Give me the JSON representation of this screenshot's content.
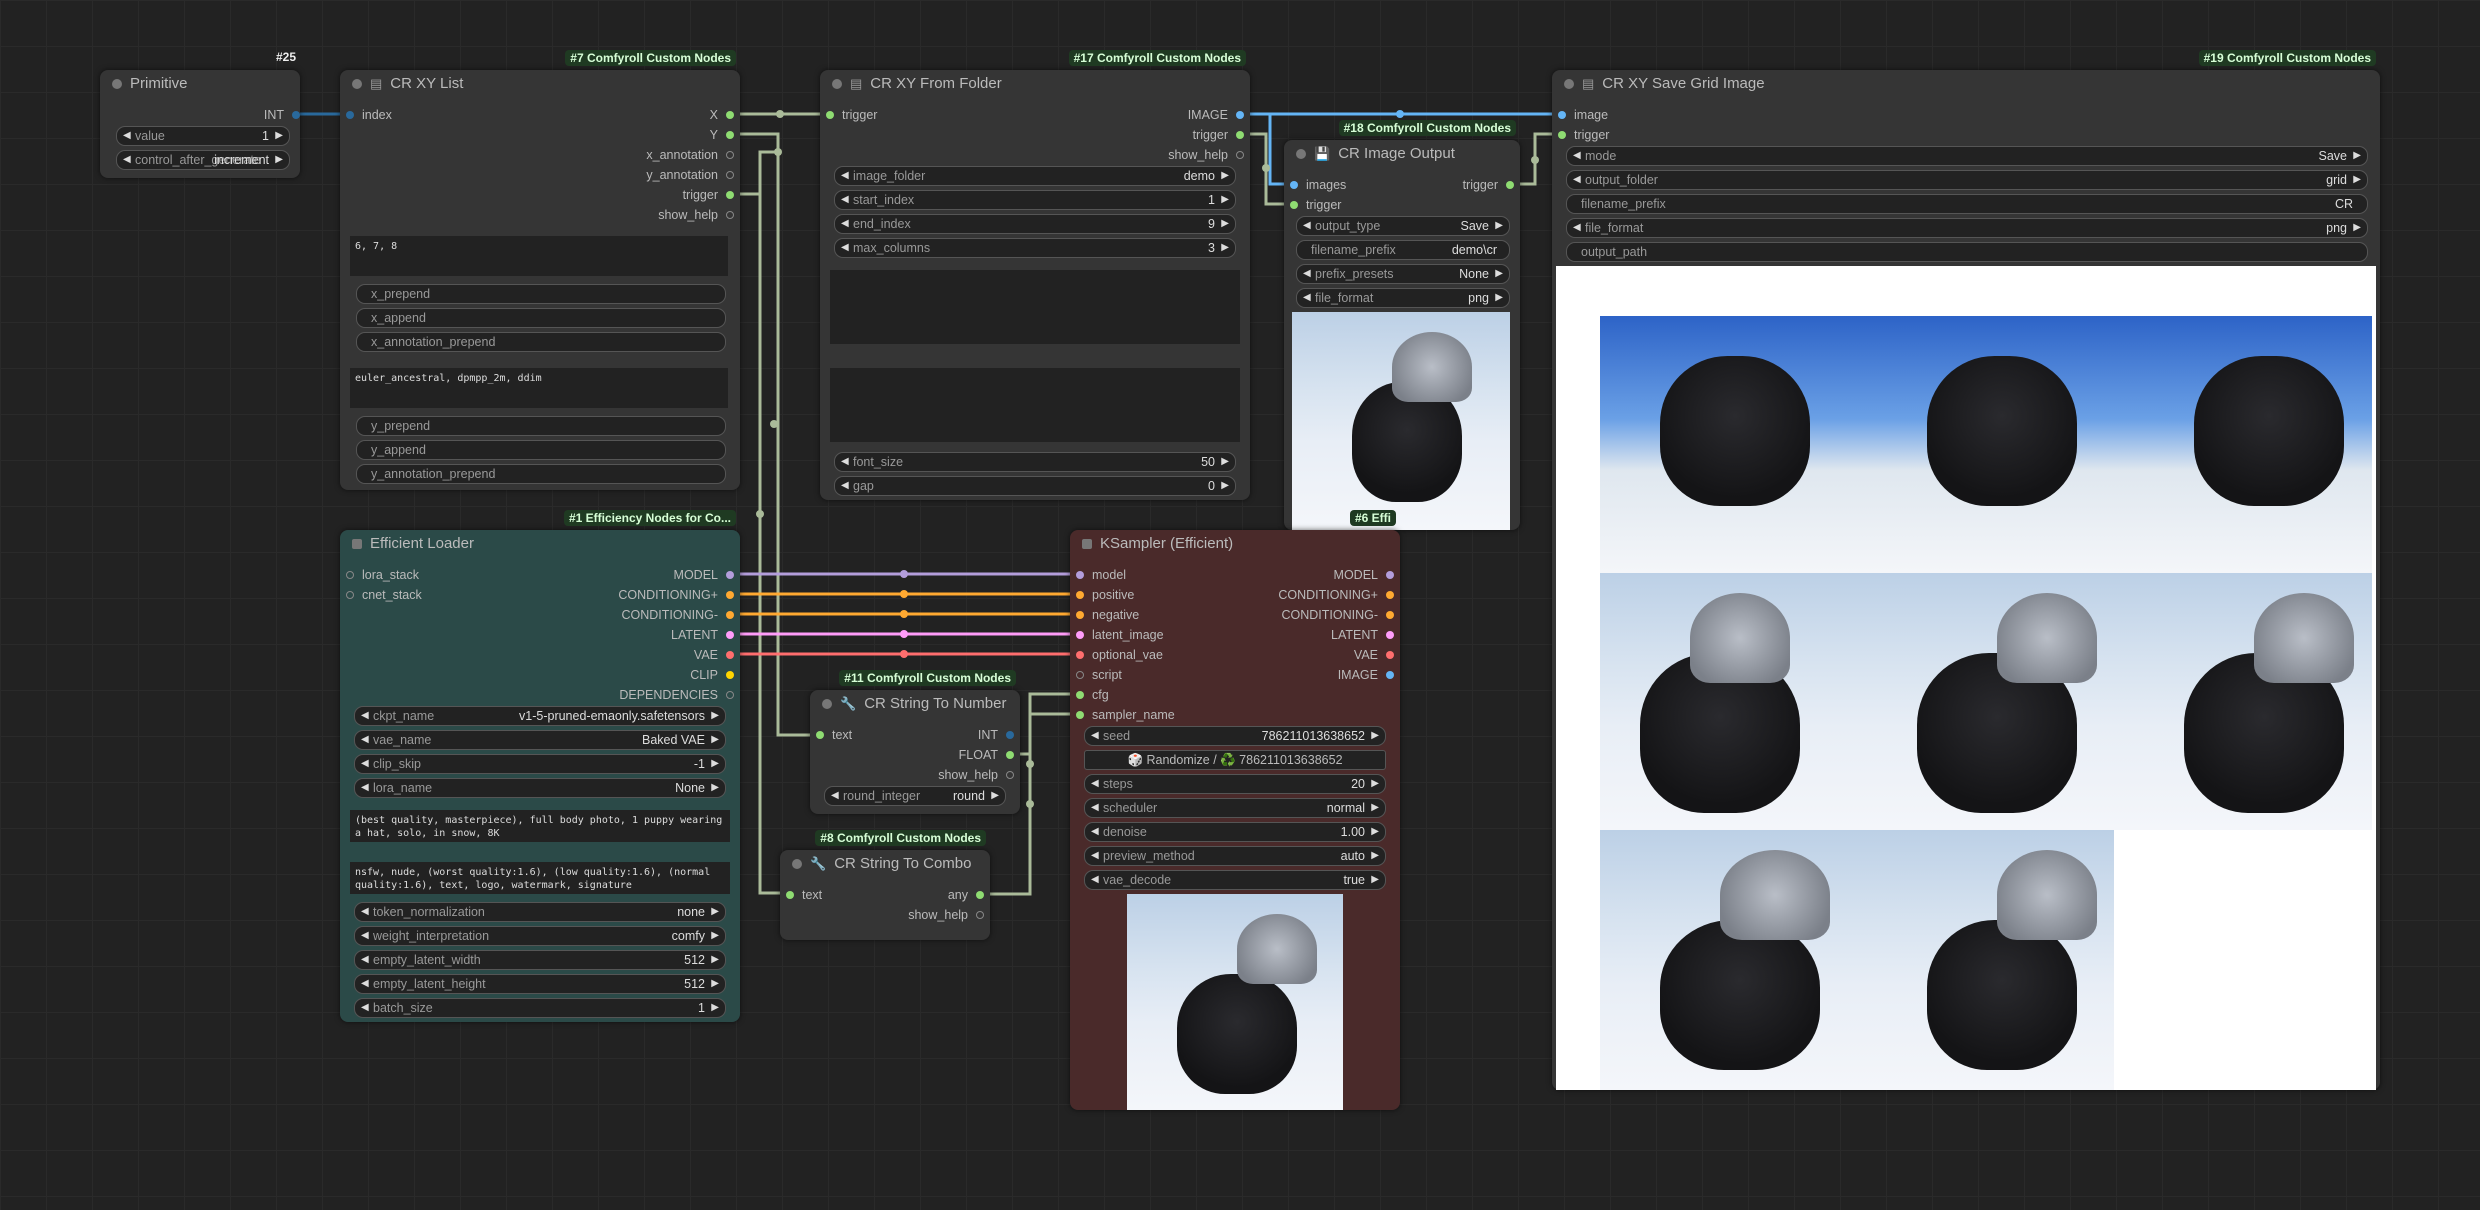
{
  "nodes": {
    "primitive": {
      "title": "Primitive",
      "id": "#25",
      "out_type": "INT",
      "value_label": "value",
      "value": "1",
      "control_label": "control_after_generate",
      "control_value": "increment"
    },
    "xy_list": {
      "title": "CR XY List",
      "badge": "#7 Comfyroll Custom Nodes",
      "input": "index",
      "outputs": [
        "X",
        "Y",
        "x_annotation",
        "y_annotation",
        "trigger",
        "show_help"
      ],
      "x_text": "6, 7, 8",
      "x_fields": [
        "x_prepend",
        "x_append",
        "x_annotation_prepend"
      ],
      "y_text": "euler_ancestral, dpmpp_2m, ddim",
      "y_fields": [
        "y_prepend",
        "y_append",
        "y_annotation_prepend"
      ]
    },
    "from_folder": {
      "title": "CR XY From Folder",
      "badge": "#17 Comfyroll Custom Nodes",
      "input": "trigger",
      "outputs": [
        "IMAGE",
        "trigger",
        "show_help"
      ],
      "widgets": [
        {
          "label": "image_folder",
          "value": "demo"
        },
        {
          "label": "start_index",
          "value": "1"
        },
        {
          "label": "end_index",
          "value": "9"
        },
        {
          "label": "max_columns",
          "value": "3"
        }
      ],
      "widgets2": [
        {
          "label": "font_size",
          "value": "50"
        },
        {
          "label": "gap",
          "value": "0"
        }
      ]
    },
    "image_output": {
      "title": "CR Image Output",
      "badge": "#18 Comfyroll Custom Nodes",
      "inputs": [
        "images",
        "trigger"
      ],
      "output": "trigger",
      "widgets": [
        {
          "label": "output_type",
          "value": "Save"
        },
        {
          "label": "filename_prefix",
          "value": "demo\\cr"
        },
        {
          "label": "prefix_presets",
          "value": "None"
        },
        {
          "label": "file_format",
          "value": "png"
        }
      ]
    },
    "save_grid": {
      "title": "CR XY Save Grid Image",
      "badge": "#19 Comfyroll Custom Nodes",
      "inputs": [
        "image",
        "trigger"
      ],
      "widgets": [
        {
          "label": "mode",
          "value": "Save"
        },
        {
          "label": "output_folder",
          "value": "grid"
        },
        {
          "label": "filename_prefix",
          "value": "CR"
        },
        {
          "label": "file_format",
          "value": "png"
        },
        {
          "label": "output_path",
          "value": ""
        }
      ]
    },
    "loader": {
      "title": "Efficient Loader",
      "badge": "#1 Efficiency Nodes for Co...",
      "inputs": [
        "lora_stack",
        "cnet_stack"
      ],
      "outputs": [
        "MODEL",
        "CONDITIONING+",
        "CONDITIONING-",
        "LATENT",
        "VAE",
        "CLIP",
        "DEPENDENCIES"
      ],
      "widgets": [
        {
          "label": "ckpt_name",
          "value": "v1-5-pruned-emaonly.safetensors"
        },
        {
          "label": "vae_name",
          "value": "Baked VAE"
        },
        {
          "label": "clip_skip",
          "value": "-1"
        },
        {
          "label": "lora_name",
          "value": "None"
        }
      ],
      "positive": "(best quality, masterpiece), full body photo, 1 puppy wearing a hat, solo, in snow, 8K",
      "negative": "nsfw, nude, (worst quality:1.6), (low quality:1.6), (normal quality:1.6), text, logo, watermark, signature",
      "widgets2": [
        {
          "label": "token_normalization",
          "value": "none"
        },
        {
          "label": "weight_interpretation",
          "value": "comfy"
        },
        {
          "label": "empty_latent_width",
          "value": "512"
        },
        {
          "label": "empty_latent_height",
          "value": "512"
        },
        {
          "label": "batch_size",
          "value": "1"
        }
      ]
    },
    "str_to_num": {
      "title": "CR String To Number",
      "badge": "#11 Comfyroll Custom Nodes",
      "input": "text",
      "outputs": [
        "INT",
        "FLOAT",
        "show_help"
      ],
      "widget": {
        "label": "round_integer",
        "value": "round"
      }
    },
    "str_to_combo": {
      "title": "CR String To Combo",
      "badge": "#8 Comfyroll Custom Nodes",
      "input": "text",
      "outputs": [
        "any",
        "show_help"
      ]
    },
    "ksampler": {
      "title": "KSampler (Efficient)",
      "badge": "#6 Effi",
      "inputs": [
        "model",
        "positive",
        "negative",
        "latent_image",
        "optional_vae",
        "script",
        "cfg",
        "sampler_name"
      ],
      "outputs": [
        "MODEL",
        "CONDITIONING+",
        "CONDITIONING-",
        "LATENT",
        "VAE",
        "IMAGE"
      ],
      "seed_label": "seed",
      "seed": "786211013638652",
      "randomize": "🎲 Randomize / ♻️ 786211013638652",
      "widgets": [
        {
          "label": "steps",
          "value": "20"
        },
        {
          "label": "scheduler",
          "value": "normal"
        },
        {
          "label": "denoise",
          "value": "1.00"
        },
        {
          "label": "preview_method",
          "value": "auto"
        },
        {
          "label": "vae_decode",
          "value": "true"
        }
      ]
    }
  },
  "colors": {
    "model": "#b39ddb",
    "conditioning": "#ffa931",
    "latent": "#ff9cf9",
    "vae": "#ff6e6e",
    "image": "#64b5f6",
    "int": "#29699c",
    "generic": "#aabb99",
    "loader_bg": "#2b4a48",
    "ksampler_bg": "#4a2a2a"
  }
}
